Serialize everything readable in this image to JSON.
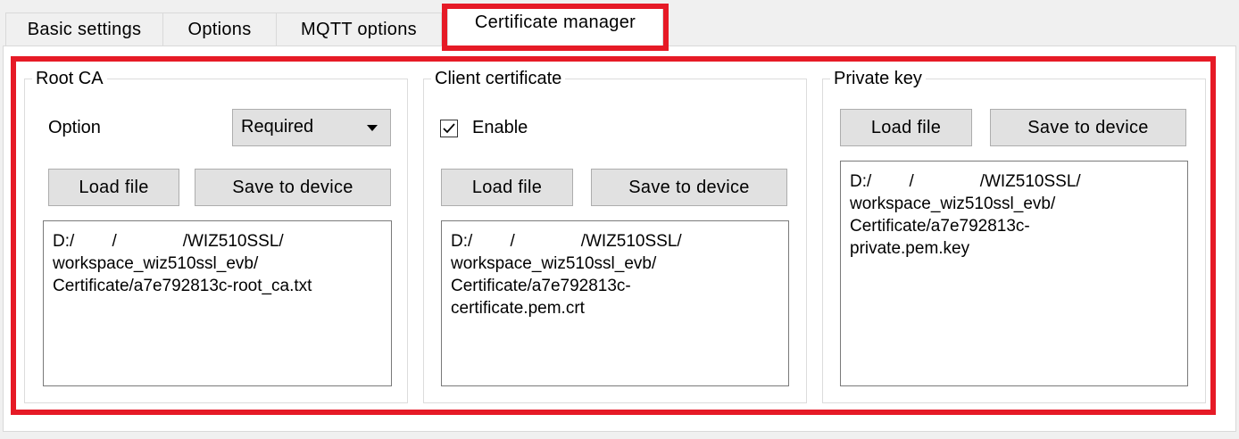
{
  "tabs": [
    {
      "label": "Basic settings"
    },
    {
      "label": "Options"
    },
    {
      "label": "MQTT options"
    },
    {
      "label": "Certificate manager",
      "active": true
    }
  ],
  "root_ca": {
    "title": "Root CA",
    "option_label": "Option",
    "option_value": "Required",
    "load_file": "Load file",
    "save_to_device": "Save to device",
    "path": "D:/        /              /WIZ510SSL/\nworkspace_wiz510ssl_evb/\nCertificate/a7e792813c-root_ca.txt"
  },
  "client_certificate": {
    "title": "Client certificate",
    "enable_label": "Enable",
    "enable_checked": true,
    "load_file": "Load file",
    "save_to_device": "Save to device",
    "path": "D:/        /              /WIZ510SSL/\nworkspace_wiz510ssl_evb/\nCertificate/a7e792813c-\ncertificate.pem.crt"
  },
  "private_key": {
    "title": "Private key",
    "load_file": "Load file",
    "save_to_device": "Save to device",
    "path": "D:/        /              /WIZ510SSL/\nworkspace_wiz510ssl_evb/\nCertificate/a7e792813c-\nprivate.pem.key"
  },
  "colors": {
    "highlight": "#e61a26",
    "button_bg": "#e1e1e1",
    "panel_bg": "#ffffff",
    "window_bg": "#f0f0f0"
  }
}
